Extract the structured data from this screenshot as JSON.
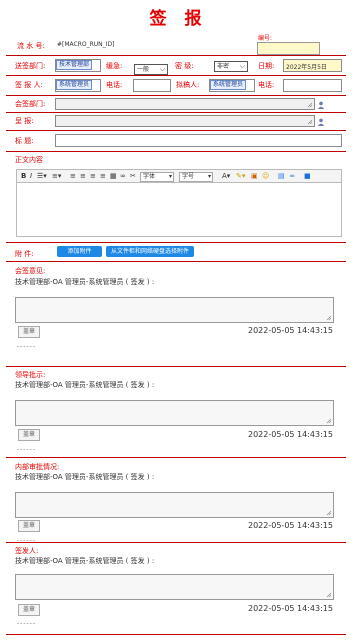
{
  "title": "签 报",
  "serial": {
    "label": "流 水 号:",
    "value": "#[MACRO_RUN_ID]"
  },
  "number": {
    "label": "编号:"
  },
  "row1": {
    "dept_label": "送签部门:",
    "dept_value": "技术管理部",
    "level_label": "缓急:",
    "level_value": "一般",
    "secret_label": "密 级:",
    "secret_value": "非密",
    "date_label": "日期:",
    "date_value": "2022年5月5日"
  },
  "row2": {
    "reporter_label": "签 报 人:",
    "reporter_value": "系统管理员",
    "phone_label": "电话:",
    "drafter_label": "拟稿人:",
    "drafter_value": "系统管理员",
    "phone2_label": "电话:"
  },
  "row3": {
    "cosign_label": "会签部门:"
  },
  "row4": {
    "report_label": "呈 报:"
  },
  "row5": {
    "subject_label": "标 题:"
  },
  "body": {
    "label": "正文内容"
  },
  "editor": {
    "font_label": "字体",
    "size_label": "字号"
  },
  "attachment": {
    "label": "附 件:",
    "add_button": "添加附件",
    "netdisk_button": "从文件柜和网络硬盘选择附件"
  },
  "sections": [
    {
      "title": "会签意见:",
      "signer": "技术管理部-OA 管理员-系统管理员 ( 签发 ) :",
      "seal": "盖章",
      "time": "2022-05-05 14:43:15",
      "dash": "------"
    },
    {
      "title": "领导批示:",
      "signer": "技术管理部-OA 管理员-系统管理员 ( 签发 ) :",
      "seal": "盖章",
      "time": "2022-05-05 14:43:15",
      "dash": "------"
    },
    {
      "title": "内部审批情况:",
      "signer": "技术管理部-OA 管理员-系统管理员 ( 签发 ) :",
      "seal": "盖章",
      "time": "2022-05-05 14:43:15",
      "dash": "------"
    },
    {
      "title": "签发人:",
      "signer": "技术管理部-OA 管理员-系统管理员 ( 签发 ) :",
      "seal": "盖章",
      "time": "2022-05-05 14:43:15",
      "dash": "------"
    }
  ],
  "colors": {
    "accent": "#e60000",
    "rule": "#c00000",
    "button": "#1e88e5",
    "number_bg": "#fff8c8"
  }
}
